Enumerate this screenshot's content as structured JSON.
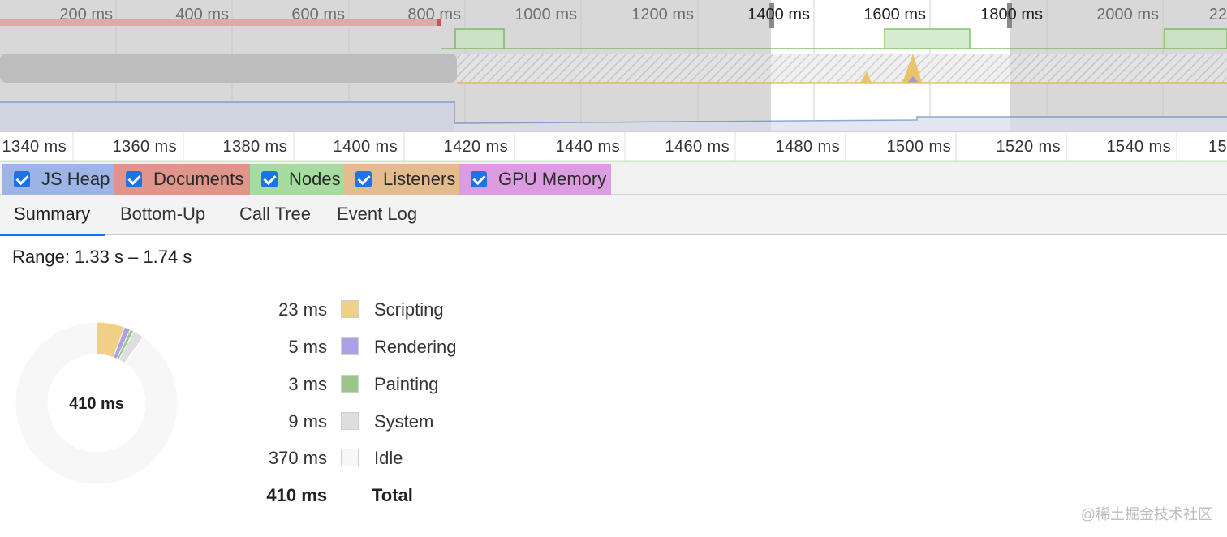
{
  "overview": {
    "ticks": [
      "200 ms",
      "400 ms",
      "600 ms",
      "800 ms",
      "1000 ms",
      "1200 ms",
      "1400 ms",
      "1600 ms",
      "1800 ms",
      "2000 ms",
      "22"
    ]
  },
  "ruler": {
    "ticks": [
      "1340 ms",
      "1360 ms",
      "1380 ms",
      "1400 ms",
      "1420 ms",
      "1440 ms",
      "1460 ms",
      "1480 ms",
      "1500 ms",
      "1520 ms",
      "1540 ms",
      "15"
    ]
  },
  "counters": [
    {
      "label": "JS Heap",
      "color": "#9db5e6",
      "checked": true
    },
    {
      "label": "Documents",
      "color": "#e0958b",
      "checked": true
    },
    {
      "label": "Nodes",
      "color": "#a7dca0",
      "checked": true
    },
    {
      "label": "Listeners",
      "color": "#e3bc8e",
      "checked": true
    },
    {
      "label": "GPU Memory",
      "color": "#dc9de0",
      "checked": true
    }
  ],
  "tabs": [
    {
      "label": "Summary",
      "active": true
    },
    {
      "label": "Bottom-Up",
      "active": false
    },
    {
      "label": "Call Tree",
      "active": false
    },
    {
      "label": "Event Log",
      "active": false
    }
  ],
  "summary": {
    "range_text": "Range: 1.33 s – 1.74 s",
    "total_center": "410 ms",
    "items": [
      {
        "value": "23 ms",
        "label": "Scripting",
        "color": "#f0d086",
        "ms": 23
      },
      {
        "value": "5 ms",
        "label": "Rendering",
        "color": "#ae9fe6",
        "ms": 5
      },
      {
        "value": "3 ms",
        "label": "Painting",
        "color": "#9bc58b",
        "ms": 3
      },
      {
        "value": "9 ms",
        "label": "System",
        "color": "#dedede",
        "ms": 9
      },
      {
        "value": "370 ms",
        "label": "Idle",
        "color": "#f7f7f7",
        "ms": 370
      }
    ],
    "total_value": "410 ms",
    "total_label": "Total"
  },
  "watermark": "@稀土掘金技术社区"
}
